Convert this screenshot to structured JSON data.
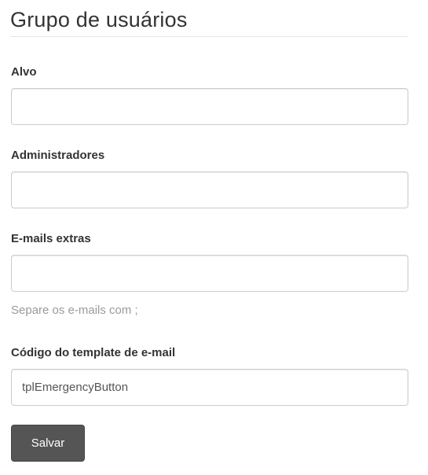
{
  "page": {
    "title": "Grupo de usuários"
  },
  "form": {
    "alvo": {
      "label": "Alvo",
      "value": ""
    },
    "administradores": {
      "label": "Administradores",
      "value": ""
    },
    "emails_extras": {
      "label": "E-mails extras",
      "value": "",
      "help": "Separe os e-mails com ;"
    },
    "template": {
      "label": "Código do template de e-mail",
      "value": "tplEmergencyButton"
    },
    "save_label": "Salvar"
  }
}
